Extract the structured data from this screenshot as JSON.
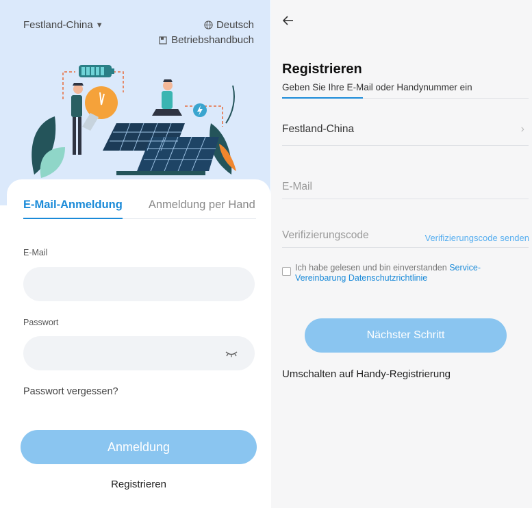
{
  "login": {
    "region": "Festland-China",
    "language": "Deutsch",
    "manual": "Betriebshandbuch",
    "tabs": [
      {
        "label": "E-Mail-Anmeldung",
        "active": true
      },
      {
        "label": "Anmeldung per Hand",
        "active": false
      }
    ],
    "email_label": "E-Mail",
    "email_value": "",
    "password_label": "Passwort",
    "password_value": "",
    "forgot": "Passwort vergessen?",
    "login_button": "Anmeldung",
    "register_link": "Registrieren"
  },
  "register": {
    "title": "Registrieren",
    "subtitle": "Geben Sie Ihre E-Mail oder Handynummer ein",
    "region": "Festland-China",
    "email_placeholder": "E-Mail",
    "code_placeholder": "Verifizierungscode",
    "send_code": "Verifizierungscode senden",
    "agree_prefix": "Ich habe gelesen und bin einverstanden",
    "agree_service": "Service-Vereinbarung",
    "agree_privacy": "Datenschutzrichtlinie",
    "next_button": "Nächster Schritt",
    "switch_link": "Umschalten auf Handy-Registrierung"
  },
  "colors": {
    "accent": "#1a8ad8",
    "button": "#8ac5f0",
    "hero_bg": "#dbe9fb",
    "link_light": "#56aef0"
  }
}
